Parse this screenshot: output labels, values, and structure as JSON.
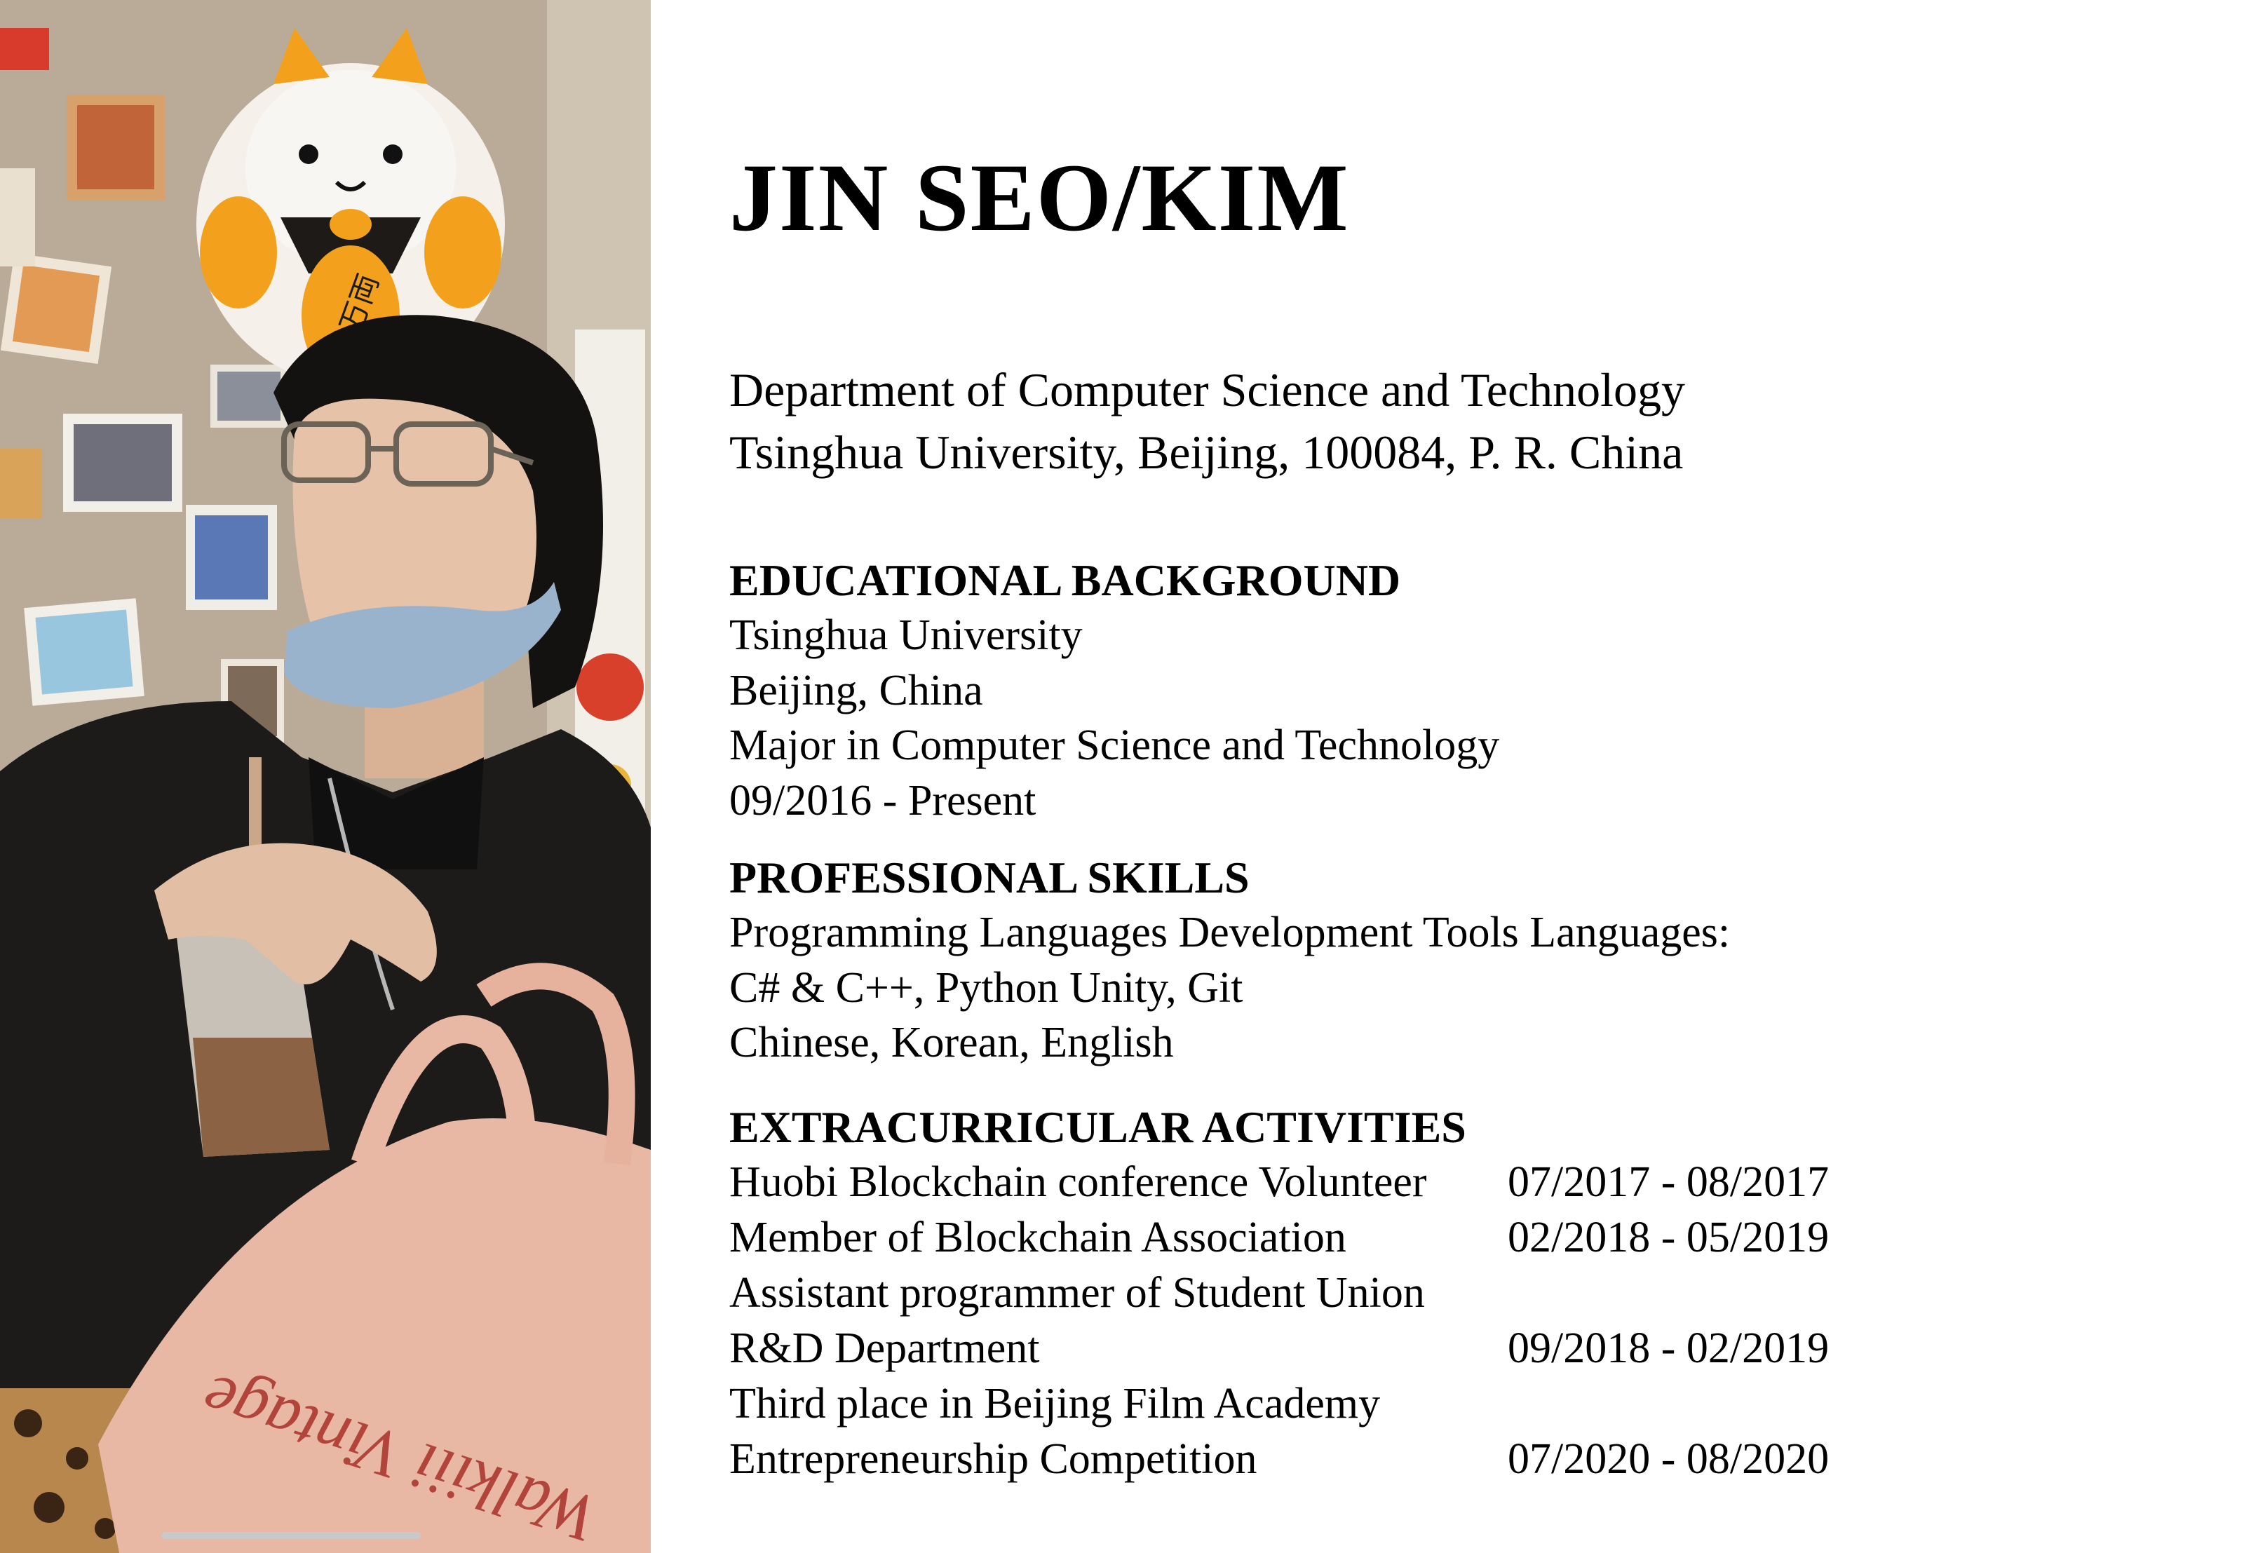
{
  "header": {
    "name": "JIN SEO/KIM",
    "address_lines": [
      "Department of Computer Science and Technology",
      "Tsinghua University, Beijing, 100084, P. R. China"
    ]
  },
  "education": {
    "heading": "EDUCATIONAL BACKGROUND",
    "lines": [
      "Tsinghua University",
      "Beijing, China",
      "Major in Computer Science and Technology",
      "09/2016 - Present"
    ]
  },
  "skills": {
    "heading": "PROFESSIONAL SKILLS",
    "lines": [
      "Programming Languages Development Tools Languages:",
      "C# & C++, Python Unity, Git",
      "Chinese, Korean, English"
    ]
  },
  "activities": {
    "heading": "EXTRACURRICULAR ACTIVITIES",
    "rows": [
      {
        "name": "Huobi Blockchain conference Volunteer",
        "date": "07/2017 - 08/2017"
      },
      {
        "name": "Member of Blockchain Association",
        "date": "02/2018 - 05/2019"
      },
      {
        "name": "Assistant programmer of Student Union",
        "date": ""
      },
      {
        "name": "R&D Department",
        "date": "09/2018 - 02/2019"
      },
      {
        "name": "Third place in Beijing Film Academy",
        "date": ""
      },
      {
        "name": "Entrepreneurship Competition",
        "date": "07/2020 - 08/2020"
      }
    ]
  },
  "photo": {
    "figurine_text": "千万両",
    "bag_text": "Walkiii Vintage",
    "colors": {
      "wall": "#b9ab98",
      "jacket": "#1c1b1a",
      "skin": "#e6c3a8",
      "hair": "#141210",
      "mask": "#9ab3cc",
      "bag": "#e8b8a4",
      "figurine": "#f3a11c"
    }
  }
}
